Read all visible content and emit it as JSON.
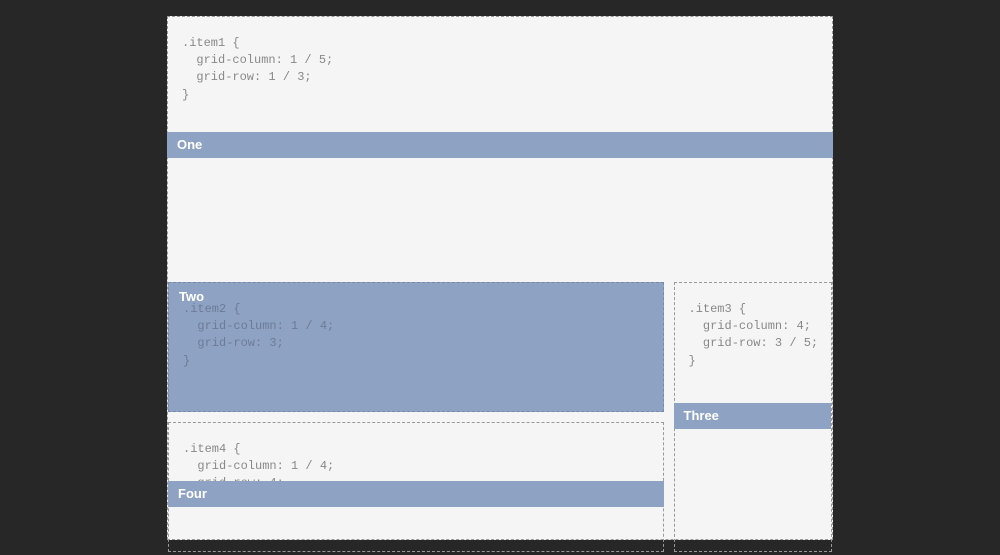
{
  "items": [
    {
      "label": "One",
      "selector": ".item1",
      "css": {
        "grid-column": "1 / 5",
        "grid-row": "1 / 3"
      }
    },
    {
      "label": "Two",
      "selector": ".item2",
      "css": {
        "grid-column": "1 / 4",
        "grid-row": "3"
      }
    },
    {
      "label": "Three",
      "selector": ".item3",
      "css": {
        "grid-column": "4",
        "grid-row": "3 / 5"
      }
    },
    {
      "label": "Four",
      "selector": ".item4",
      "css": {
        "grid-column": "1 / 4",
        "grid-row": "4"
      }
    }
  ]
}
